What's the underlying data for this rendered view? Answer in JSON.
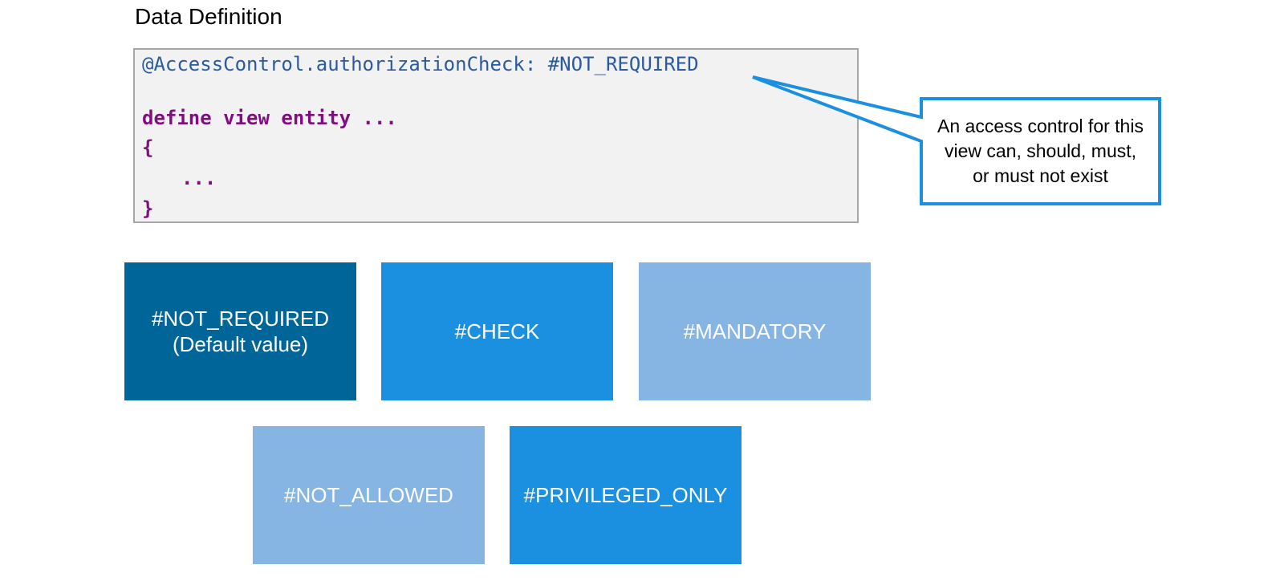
{
  "title": "Data Definition",
  "code": {
    "line1": "@AccessControl.authorizationCheck: #NOT_REQUIRED",
    "line2": "define view entity ...",
    "line3": "{",
    "line4": "...",
    "line5": "}"
  },
  "callout": {
    "text": "An access control for this view can, should, must, or must not exist"
  },
  "tiles": [
    {
      "line1": "#NOT_REQUIRED",
      "line2": "(Default value)",
      "color": "#006699"
    },
    {
      "line1": "#CHECK",
      "color": "#1b90e0"
    },
    {
      "line1": "#MANDATORY",
      "color": "#86b4e3"
    },
    {
      "line1": "#NOT_ALLOWED",
      "color": "#86b4e3"
    },
    {
      "line1": "#PRIVILEGED_ONLY",
      "color": "#1b90e0"
    }
  ],
  "colors": {
    "callout_border": "#1b90e0",
    "annotation_text": "#2b5a9e",
    "keyword_text": "#7f0f7f"
  }
}
